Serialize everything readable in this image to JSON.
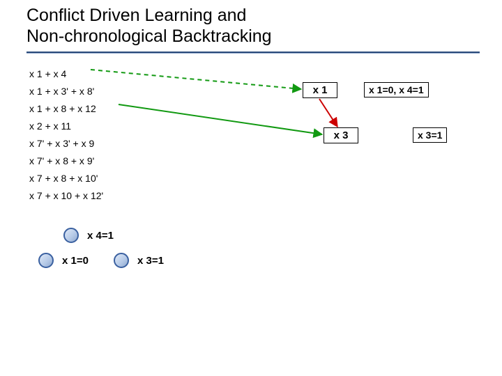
{
  "title_line1": "Conflict Driven Learning and",
  "title_line2": "Non-chronological Backtracking",
  "clauses": [
    "x 1 + x 4",
    "x 1 + x 3' + x 8'",
    "x 1 + x 8 + x 12",
    "x 2 + x 11",
    "x 7' + x 3' + x 9",
    "x 7' + x 8 + x 9'",
    "x 7 + x 8 + x 10'",
    "x 7 + x 10 + x 12'"
  ],
  "nodes": {
    "x1": "x 1",
    "x3": "x 3"
  },
  "labels": {
    "x1": "x 1=0, x 4=1",
    "x3": "x 3=1"
  },
  "legend": {
    "x4": "x 4=1",
    "x1": "x 1=0",
    "x3": "x 3=1"
  }
}
